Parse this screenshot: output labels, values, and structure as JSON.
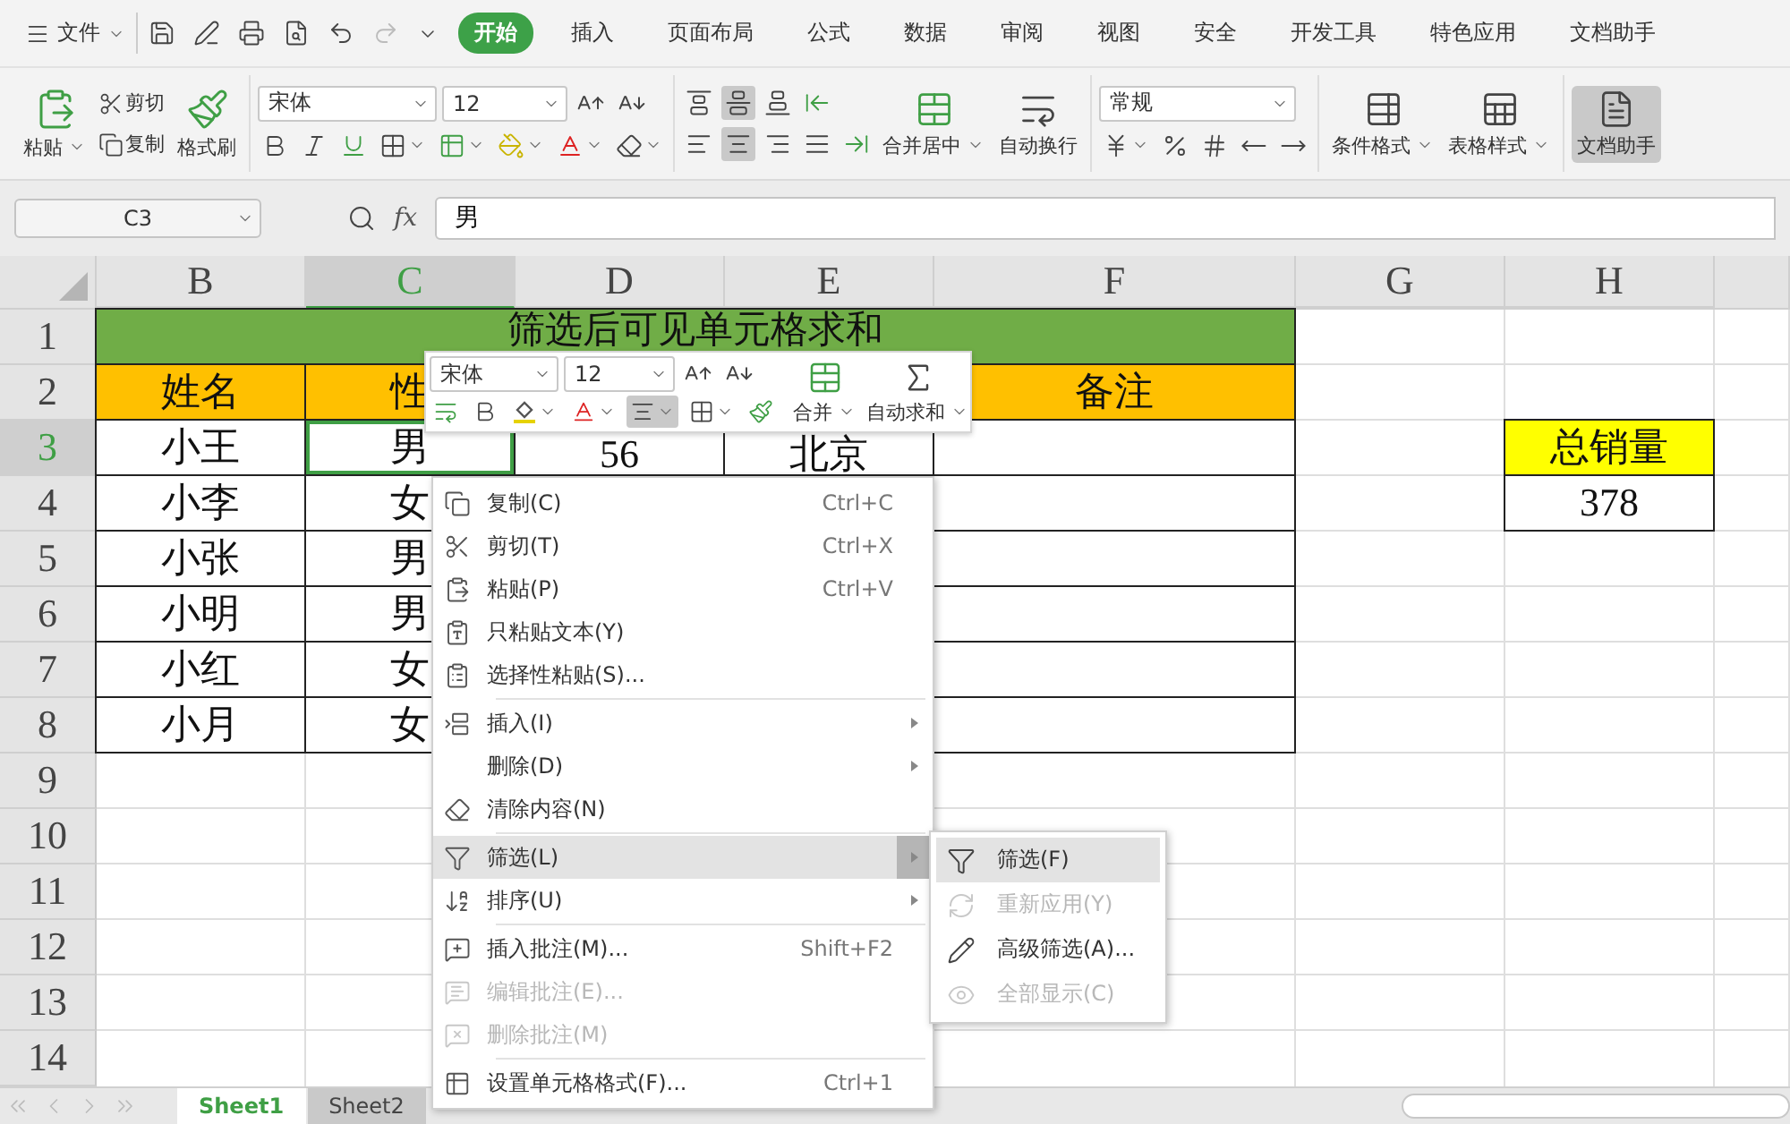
{
  "menu_bar": {
    "file_menu": "文件",
    "tabs": [
      {
        "label": "开始",
        "selected": true
      },
      {
        "label": "插入",
        "selected": false
      },
      {
        "label": "页面布局",
        "selected": false
      },
      {
        "label": "公式",
        "selected": false
      },
      {
        "label": "数据",
        "selected": false
      },
      {
        "label": "审阅",
        "selected": false
      },
      {
        "label": "视图",
        "selected": false
      },
      {
        "label": "安全",
        "selected": false
      },
      {
        "label": "开发工具",
        "selected": false
      },
      {
        "label": "特色应用",
        "selected": false
      },
      {
        "label": "文档助手",
        "selected": false
      }
    ]
  },
  "ribbon": {
    "paste": "粘贴",
    "cut": "剪切",
    "copy": "复制",
    "format_painter": "格式刷",
    "font": {
      "name": "宋体",
      "size": "12"
    },
    "vertical_alignment": [
      {
        "kind": "top",
        "selected": false
      },
      {
        "kind": "middle",
        "selected": true
      },
      {
        "kind": "bottom",
        "selected": false
      }
    ],
    "horizontal_alignment": [
      {
        "kind": "left",
        "selected": false
      },
      {
        "kind": "center",
        "selected": true
      },
      {
        "kind": "right",
        "selected": false
      },
      {
        "kind": "justify",
        "selected": false
      }
    ],
    "merge": "合并居中",
    "wrap": "自动换行",
    "number_format": "常规",
    "styles": [
      {
        "kind": "conditional",
        "label": "条件格式"
      },
      {
        "kind": "table",
        "label": "表格样式"
      }
    ],
    "assistant": {
      "label": "文档助手",
      "selected": true
    }
  },
  "formula_bar": {
    "name_box": "C3",
    "fx_label": "fx",
    "value": "男"
  },
  "sheet": {
    "columns": [
      {
        "label": "B",
        "selected": false
      },
      {
        "label": "C",
        "selected": true
      },
      {
        "label": "D",
        "selected": false
      },
      {
        "label": "E",
        "selected": false
      },
      {
        "label": "F",
        "selected": false
      },
      {
        "label": "G",
        "selected": false
      },
      {
        "label": "H",
        "selected": false
      }
    ],
    "rows": [
      {
        "label": "1",
        "selected": false
      },
      {
        "label": "2",
        "selected": false
      },
      {
        "label": "3",
        "selected": true
      },
      {
        "label": "4",
        "selected": false
      },
      {
        "label": "5",
        "selected": false
      },
      {
        "label": "6",
        "selected": false
      },
      {
        "label": "7",
        "selected": false
      },
      {
        "label": "8",
        "selected": false
      },
      {
        "label": "9",
        "selected": false
      },
      {
        "label": "10",
        "selected": false
      },
      {
        "label": "11",
        "selected": false
      },
      {
        "label": "12",
        "selected": false
      },
      {
        "label": "13",
        "selected": false
      },
      {
        "label": "14",
        "selected": false
      }
    ],
    "title": "筛选后可见单元格求和",
    "header": {
      "cells": [
        "姓名",
        "性"
      ],
      "remark": "备注"
    },
    "data": [
      {
        "cells": [
          {
            "text": "小王",
            "selected": false
          },
          {
            "text": "男",
            "selected": true
          },
          {
            "text": "56",
            "selected": false
          },
          {
            "text": "北京",
            "selected": false
          }
        ]
      },
      {
        "cells": [
          {
            "text": "小李",
            "selected": false
          },
          {
            "text": "女",
            "selected": false
          }
        ]
      },
      {
        "cells": [
          {
            "text": "小张",
            "selected": false
          },
          {
            "text": "男",
            "selected": false
          }
        ]
      },
      {
        "cells": [
          {
            "text": "小明",
            "selected": false
          },
          {
            "text": "男",
            "selected": false
          }
        ]
      },
      {
        "cells": [
          {
            "text": "小红",
            "selected": false
          },
          {
            "text": "女",
            "selected": false
          }
        ]
      },
      {
        "cells": [
          {
            "text": "小月",
            "selected": false
          },
          {
            "text": "女",
            "selected": false
          }
        ]
      }
    ],
    "summary": {
      "label": "总销量",
      "value": "378"
    }
  },
  "mini_toolbar": {
    "font": "宋体",
    "size": "12",
    "center_align_selected": true,
    "merge": "合并",
    "autosum": "自动求和"
  },
  "context_menu": {
    "groups": [
      [
        {
          "kind": "copy",
          "label": "复制(C)",
          "shortcut": "Ctrl+C",
          "disabled": false,
          "selected": false,
          "has_submenu": false
        },
        {
          "kind": "cut",
          "label": "剪切(T)",
          "shortcut": "Ctrl+X",
          "disabled": false,
          "selected": false,
          "has_submenu": false
        },
        {
          "kind": "paste",
          "label": "粘贴(P)",
          "shortcut": "Ctrl+V",
          "disabled": false,
          "selected": false,
          "has_submenu": false
        },
        {
          "kind": "paste_text",
          "label": "只粘贴文本(Y)",
          "disabled": false,
          "selected": false,
          "has_submenu": false
        },
        {
          "kind": "paste_special",
          "label": "选择性粘贴(S)...",
          "disabled": false,
          "selected": false,
          "has_submenu": false
        }
      ],
      [
        {
          "kind": "insert",
          "label": "插入(I)",
          "disabled": false,
          "selected": false,
          "has_submenu": true
        },
        {
          "kind": "none",
          "label": "删除(D)",
          "disabled": false,
          "selected": false,
          "has_submenu": true
        },
        {
          "kind": "clear",
          "label": "清除内容(N)",
          "disabled": false,
          "selected": false,
          "has_submenu": false
        }
      ],
      [
        {
          "kind": "filter",
          "label": "筛选(L)",
          "disabled": false,
          "selected": true,
          "has_submenu": true
        },
        {
          "kind": "sort",
          "label": "排序(U)",
          "disabled": false,
          "selected": false,
          "has_submenu": true
        }
      ],
      [
        {
          "kind": "add_comment",
          "label": "插入批注(M)...",
          "shortcut": "Shift+F2",
          "disabled": false,
          "selected": false,
          "has_submenu": false
        },
        {
          "kind": "edit_comment",
          "label": "编辑批注(E)...",
          "disabled": true,
          "selected": false,
          "has_submenu": false
        },
        {
          "kind": "delete_comment",
          "label": "删除批注(M)",
          "disabled": true,
          "selected": false,
          "has_submenu": false
        }
      ],
      [
        {
          "kind": "format_cells",
          "label": "设置单元格格式(F)...",
          "shortcut": "Ctrl+1",
          "disabled": false,
          "selected": false,
          "has_submenu": false
        }
      ]
    ]
  },
  "submenu": [
    {
      "kind": "filter",
      "label": "筛选(F)",
      "disabled": false,
      "selected": true
    },
    {
      "kind": "reapply",
      "label": "重新应用(Y)",
      "disabled": true,
      "selected": false
    },
    {
      "kind": "advanced",
      "label": "高级筛选(A)...",
      "disabled": false,
      "selected": false
    },
    {
      "kind": "show_all",
      "label": "全部显示(C)",
      "disabled": true,
      "selected": false
    }
  ],
  "sheet_tabs": [
    {
      "label": "Sheet1",
      "selected": true
    },
    {
      "label": "Sheet2",
      "selected": false
    }
  ]
}
